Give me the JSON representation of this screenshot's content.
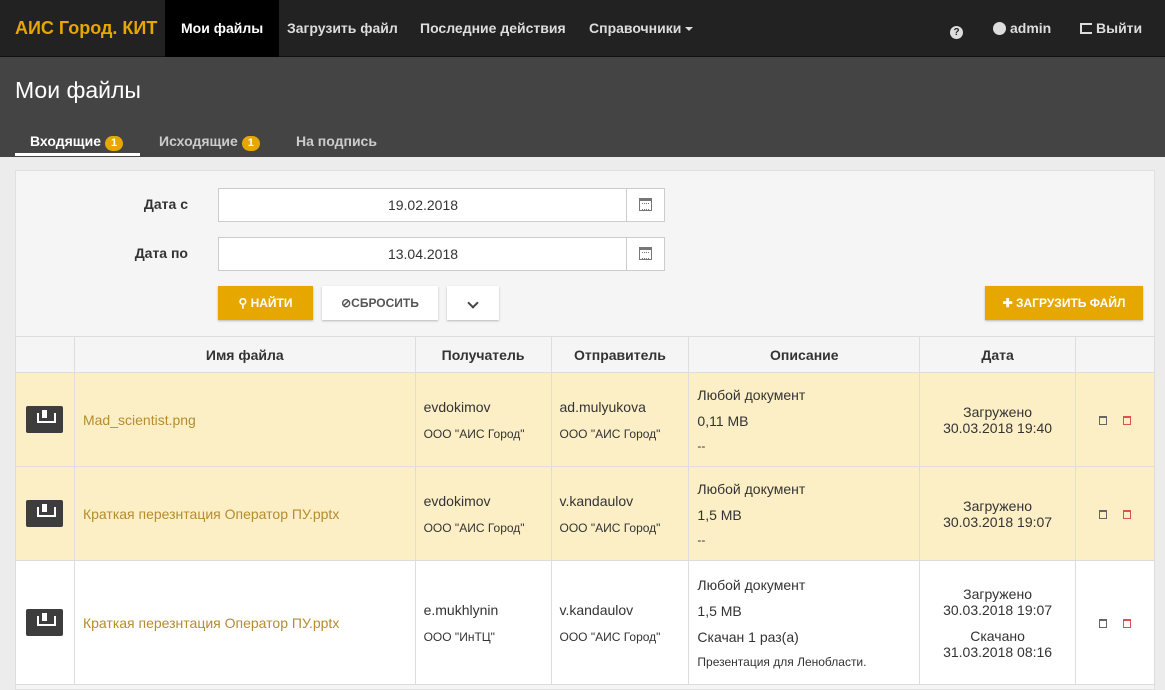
{
  "navbar": {
    "brand": "АИС Город. КИТ",
    "items": [
      {
        "label": "Мои файлы"
      },
      {
        "label": "Загрузить файл"
      },
      {
        "label": "Последние действия"
      },
      {
        "label": "Справочники"
      }
    ],
    "user": "admin",
    "logout": "Выйти",
    "help_icon": "?"
  },
  "page": {
    "title": "Мои файлы",
    "tabs": [
      {
        "label": "Входящие",
        "count": "1"
      },
      {
        "label": "Исходящие",
        "count": "1"
      },
      {
        "label": "На подпись"
      }
    ]
  },
  "filters": {
    "date_from_label": "Дата с",
    "date_from": "19.02.2018",
    "date_to_label": "Дата по",
    "date_to": "13.04.2018",
    "find_label": "НАЙТИ",
    "reset_label": "СБРОСИТЬ",
    "upload_label": "ЗАГРУЗИТЬ ФАЙЛ"
  },
  "table": {
    "headers": [
      "",
      "Имя файла",
      "Получатель",
      "Отправитель",
      "Описание",
      "Дата",
      ""
    ],
    "rows": [
      {
        "file": "Mad_scientist.png",
        "recipient": "evdokimov",
        "recipient_org": "ООО \"АИС Город\"",
        "sender": "ad.mulyukova",
        "sender_org": "ООО \"АИС Город\"",
        "desc_type": "Любой документ",
        "desc_size": "0,11 MB",
        "desc_extra": "--",
        "uploaded_label": "Загружено",
        "uploaded": "30.03.2018 19:40"
      },
      {
        "file": "Краткая перезнтация Оператор ПУ.pptx",
        "recipient": "evdokimov",
        "recipient_org": "ООО \"АИС Город\"",
        "sender": "v.kandaulov",
        "sender_org": "ООО \"АИС Город\"",
        "desc_type": "Любой документ",
        "desc_size": "1,5 MB",
        "desc_extra": "--",
        "uploaded_label": "Загружено",
        "uploaded": "30.03.2018 19:07"
      },
      {
        "file": "Краткая перезнтация Оператор ПУ.pptx",
        "recipient": "e.mukhlynin",
        "recipient_org": "ООО \"ИнТЦ\"",
        "sender": "v.kandaulov",
        "sender_org": "ООО \"АИС Город\"",
        "desc_type": "Любой документ",
        "desc_size": "1,5 MB",
        "desc_downloaded": "Скачан 1 раз(а)",
        "desc_note": "Презентация для Ленобласти.",
        "uploaded_label": "Загружено",
        "uploaded": "30.03.2018 19:07",
        "downloaded_label": "Скачано",
        "downloaded": "31.03.2018 08:16"
      }
    ]
  },
  "colors": {
    "accent": "#e6a700",
    "navbar": "#222222",
    "header": "#444444",
    "highlight_row": "#fcefc6"
  }
}
